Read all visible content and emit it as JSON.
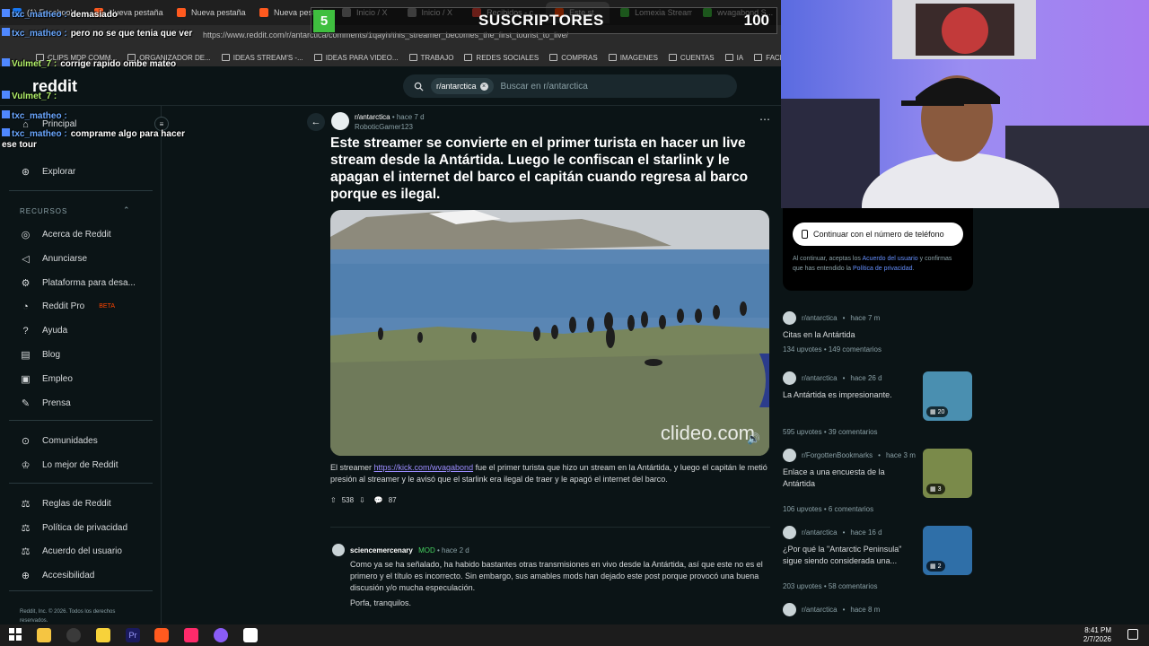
{
  "browser": {
    "tabs": [
      {
        "label": "(1) Facebook",
        "color": "#1877f2"
      },
      {
        "label": "Nueva pestaña",
        "color": "#ff5a1f"
      },
      {
        "label": "Nueva pestaña",
        "color": "#ff5a1f"
      },
      {
        "label": "Nueva pestaña",
        "color": "#ff5a1f"
      },
      {
        "label": "Inicio / X",
        "color": "#888888"
      },
      {
        "label": "Inicio / X",
        "color": "#888888"
      },
      {
        "label": "Recibidos - c...",
        "color": "#ea4335"
      },
      {
        "label": "Este st...",
        "color": "#ff4500"
      },
      {
        "label": "Lomexia Stream",
        "color": "#3fbf3f"
      },
      {
        "label": "wvagabond S...",
        "color": "#3fbf3f"
      }
    ],
    "url": "https://www.reddit.com/r/antarctica/comments/1qayh/this_streamer_becomes_the_first_tourist_to_live/",
    "bookmarks": [
      "CLIPS MDP COMM...",
      "ORGANIZADOR DE...",
      "IDEAS STREAM'S -...",
      "IDEAS PARA VIDEO...",
      "TRABAJO",
      "REDES SOCIALES",
      "COMPRAS",
      "IMAGENES",
      "CUENTAS",
      "IA",
      "FACEBO..."
    ]
  },
  "header": {
    "logo": "reddit",
    "search_chip": "r/antarctica",
    "search_placeholder": "Buscar en r/antarctica"
  },
  "sidebar": {
    "top": [
      {
        "label": "Principal",
        "icon": "home-icon"
      },
      {
        "label": "Explorar",
        "icon": "explore-icon"
      }
    ],
    "resources_label": "RECURSOS",
    "resources": [
      {
        "label": "Acerca de Reddit",
        "icon": "reddit-icon"
      },
      {
        "label": "Anunciarse",
        "icon": "megaphone-icon"
      },
      {
        "label": "Plataforma para desa...",
        "icon": "gear-icon"
      },
      {
        "label": "Reddit Pro",
        "icon": "pro-icon",
        "badge": "BETA"
      },
      {
        "label": "Ayuda",
        "icon": "help-icon"
      },
      {
        "label": "Blog",
        "icon": "book-icon"
      },
      {
        "label": "Empleo",
        "icon": "briefcase-icon"
      },
      {
        "label": "Prensa",
        "icon": "mic-icon"
      }
    ],
    "communities": [
      {
        "label": "Comunidades",
        "icon": "communities-icon"
      },
      {
        "label": "Lo mejor de Reddit",
        "icon": "trophy-icon"
      }
    ],
    "policies": [
      {
        "label": "Reglas de Reddit",
        "icon": "rules-icon"
      },
      {
        "label": "Política de privacidad",
        "icon": "privacy-icon"
      },
      {
        "label": "Acuerdo del usuario",
        "icon": "agreement-icon"
      },
      {
        "label": "Accesibilidad",
        "icon": "accessibility-icon"
      }
    ],
    "copyright": "Reddit, Inc. © 2026. Todos los derechos reservados."
  },
  "post": {
    "subreddit": "r/antarctica",
    "time": "hace 7 d",
    "author": "RoboticGamer123",
    "title": "Este streamer se convierte en el primer turista en hacer un live stream desde la Antártida. Luego le confiscan el starlink y le apagan el internet del barco el capitán cuando regresa al barco porque es ilegal.",
    "watermark": "clideo.com",
    "body_prefix": "El streamer ",
    "body_link": "https://kick.com/wvagabond",
    "body_suffix": " fue el primer turista que hizo un stream en la Antártida, y luego el capitán le metió presión al streamer y le avisó que el starlink era ilegal de traer y le apagó el internet del barco.",
    "upvotes": "538",
    "comments": "87"
  },
  "comment": {
    "user": "sciencemercenary",
    "role": "MOD",
    "time": "hace 2 d",
    "text": "Como ya se ha señalado, ha habido bastantes otras transmisiones en vivo desde la Antártida, así que este no es el primero y el título es incorrecto. Sin embargo, sus amables mods han dejado este post porque provocó una buena discusión y/o mucha especulación.",
    "text2": "Porfa, tranquilos."
  },
  "auth": {
    "phone_button": "Continuar con el número de teléfono",
    "legal_1": "Al continuar, aceptas los ",
    "legal_link1": "Acuerdo del usuario",
    "legal_2": " y confirmas que has entendido la ",
    "legal_link2": "Política de privacidad",
    "legal_3": "."
  },
  "related": [
    {
      "sub": "r/antarctica",
      "time": "hace 7 m",
      "title": "Citas en la Antártida",
      "upvotes": "134 upvotes",
      "comments": "149 comentarios",
      "thumb": null
    },
    {
      "sub": "r/antarctica",
      "time": "hace 26 d",
      "title": "La Antártida es impresionante.",
      "upvotes": "595 upvotes",
      "comments": "39 comentarios",
      "thumb": {
        "count": "20",
        "color": "#4a8fb0"
      }
    },
    {
      "sub": "r/ForgottenBookmarks",
      "time": "hace 3 m",
      "title": "Enlace a una encuesta de la Antártida",
      "upvotes": "106 upvotes",
      "comments": "6 comentarios",
      "thumb": {
        "count": "3",
        "color": "#7a8a4a"
      }
    },
    {
      "sub": "r/antarctica",
      "time": "hace 16 d",
      "title": "¿Por qué la \"Antarctic Peninsula\" sigue siendo considerada una...",
      "upvotes": "203 upvotes",
      "comments": "58 comentarios",
      "thumb": {
        "count": "2",
        "color": "#2f6fa8"
      }
    },
    {
      "sub": "r/antarctica",
      "time": "hace 8 m",
      "title": "",
      "upvotes": "",
      "comments": "",
      "thumb": null
    }
  ],
  "chat": [
    {
      "user": "txc_matheo :",
      "msg": "demasiado"
    },
    {
      "user": "txc_matheo :",
      "msg": "pero no se que tenia que ver"
    },
    {
      "user": "Vulmet_7 :",
      "msg": "corrige rapido ombe mateo"
    },
    {
      "user": "Vulmet_7 :",
      "msg": ""
    },
    {
      "user": "txc_matheo :",
      "msg": ""
    },
    {
      "user": "txc_matheo :",
      "msg": "comprame algo para hacer ese tour"
    }
  ],
  "subs_overlay": {
    "left_num": "5",
    "label": "SUSCRIPTORES",
    "count": "100"
  },
  "taskbar": {
    "time": "8:41 PM",
    "date": "2/7/2026"
  }
}
